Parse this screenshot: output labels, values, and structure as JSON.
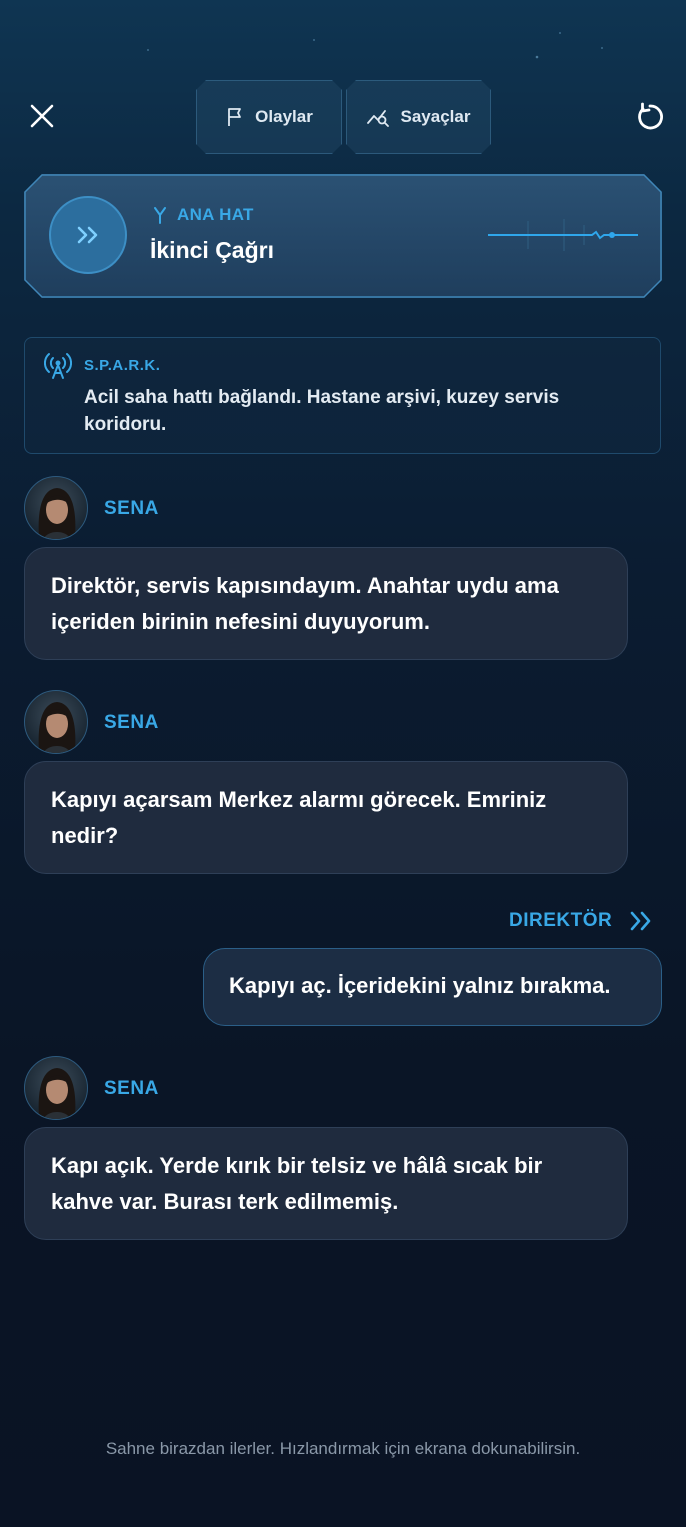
{
  "topbar": {
    "tabs": [
      {
        "label": "Olaylar",
        "icon": "flag-icon"
      },
      {
        "label": "Sayaçlar",
        "icon": "chart-search-icon"
      }
    ],
    "close_icon": "close-icon",
    "restart_icon": "restart-icon"
  },
  "line": {
    "tag": "ANA HAT",
    "title": "İkinci Çağrı",
    "icon": "double-chevron-right-icon"
  },
  "spark": {
    "name": "S.P.A.R.K.",
    "text": "Acil saha hattı bağlandı. Hastane arşivi, kuzey servis koridoru.",
    "icon": "radio-antenna-icon"
  },
  "messages": [
    {
      "speaker": "SENA",
      "text": "Direktör, servis kapısındayım. Anahtar uydu ama içeriden birinin nefesini duyuyorum."
    },
    {
      "speaker": "SENA",
      "text": "Kapıyı açarsam Merkez alarmı görecek. Emriniz nedir?"
    },
    {
      "speaker": "DIREKTÖR",
      "text": "Kapıyı aç. İçeridekini yalnız bırakma."
    },
    {
      "speaker": "SENA",
      "text": "Kapı açık. Yerde kırık bir telsiz ve hâlâ sıcak bir kahve var. Burası terk edilmemiş."
    }
  ],
  "hint": "Sahne birazdan ilerler. Hızlandırmak için ekrana dokunabilirsin.",
  "colors": {
    "accent": "#39a8e6",
    "background": "#0a1526",
    "bubble": "#1f2b3e"
  }
}
